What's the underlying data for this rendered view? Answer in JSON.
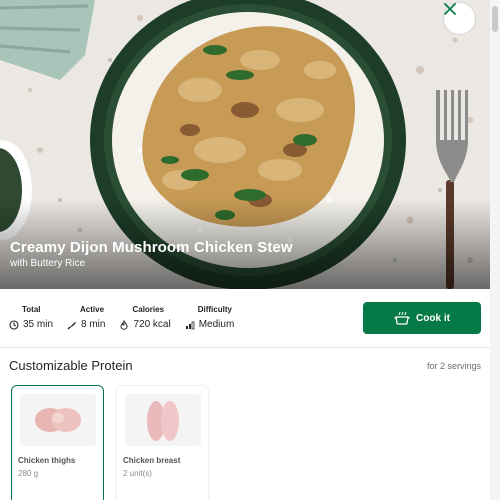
{
  "recipe": {
    "title": "Creamy Dijon Mushroom Chicken Stew",
    "subtitle": "with Buttery Rice"
  },
  "hero": {
    "close_icon": "close-icon"
  },
  "stats": [
    {
      "label": "Total",
      "value": "35 min",
      "icon": "clock-icon"
    },
    {
      "label": "Active",
      "value": "8 min",
      "icon": "knife-icon"
    },
    {
      "label": "Calories",
      "value": "720 kcal",
      "icon": "flame-icon"
    },
    {
      "label": "Difficulty",
      "value": "Medium",
      "icon": "difficulty-bars-icon"
    }
  ],
  "cook_button": {
    "label": "Cook it",
    "icon": "pot-icon"
  },
  "protein_section": {
    "title": "Customizable Protein",
    "servings": "for 2 servings",
    "options": [
      {
        "name": "Chicken thighs",
        "quantity": "280 g",
        "selected": true
      },
      {
        "name": "Chicken breast",
        "quantity": "2 unit(s)",
        "selected": false
      }
    ]
  },
  "colors": {
    "accent": "#067a46",
    "bowl": "#1e3d28",
    "background": "#ffffff"
  }
}
